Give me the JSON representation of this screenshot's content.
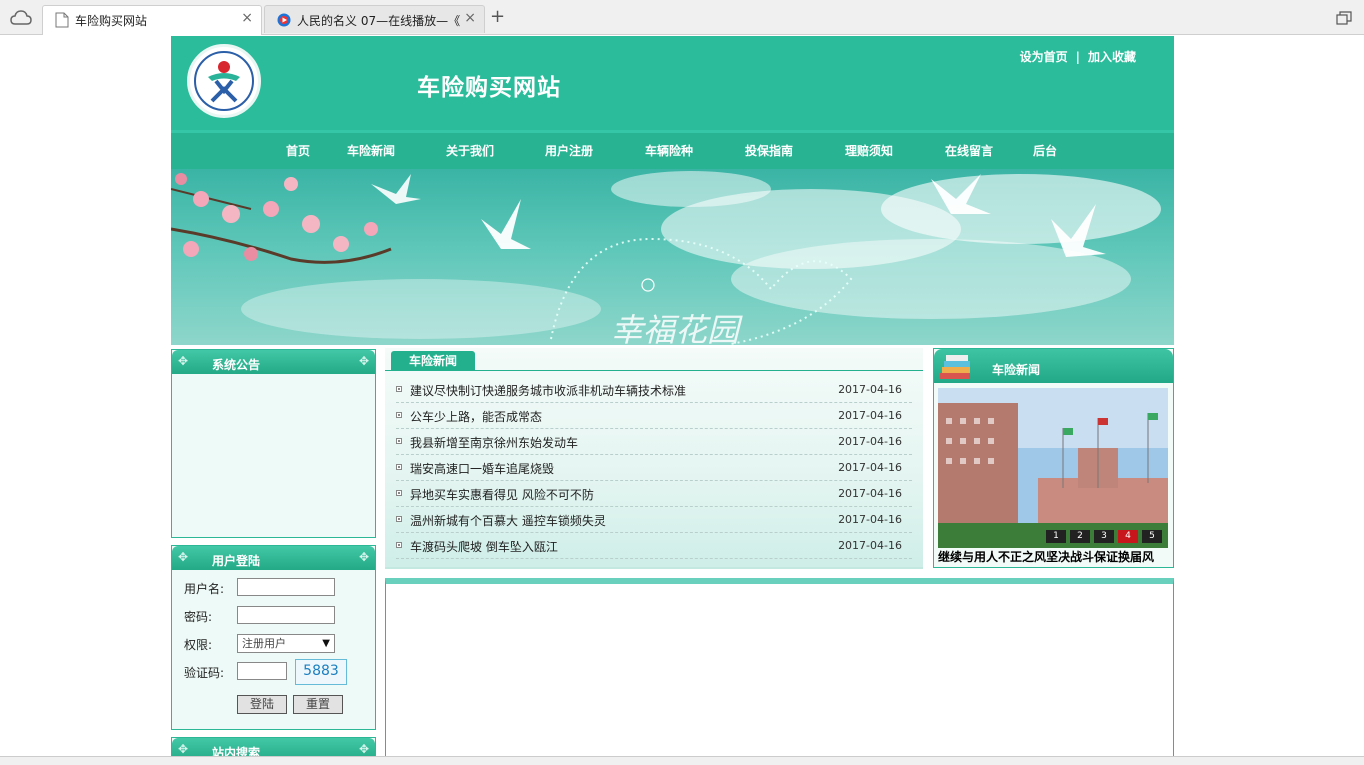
{
  "browser": {
    "tabs": [
      {
        "label": "车险购买网站",
        "active": true
      },
      {
        "label": "人民的名义 07—在线播放—《",
        "active": false
      }
    ],
    "new_tab_symbol": "+",
    "close_symbol": "×"
  },
  "header": {
    "site_title": "车险购买网站",
    "top_links": [
      "设为首页",
      "加入收藏"
    ],
    "separator": "|"
  },
  "nav": {
    "items": [
      "首页",
      "车险新闻",
      "关于我们",
      "用户注册",
      "车辆险种",
      "投保指南",
      "理赔须知",
      "在线留言",
      "后台"
    ]
  },
  "announcement": {
    "title": "系统公告"
  },
  "login": {
    "title": "用户登陆",
    "username_label": "用户名:",
    "password_label": "密码:",
    "role_label": "权限:",
    "role_selected": "注册用户",
    "captcha_label": "验证码:",
    "captcha_value": "5883",
    "login_button": "登陆",
    "reset_button": "重置"
  },
  "site_search": {
    "title": "站内搜索"
  },
  "news_center": {
    "tab_label": "车险新闻",
    "items": [
      {
        "title": "建议尽快制订快递服务城市收派非机动车辆技术标准",
        "date": "2017-04-16"
      },
      {
        "title": "公车少上路，能否成常态",
        "date": "2017-04-16"
      },
      {
        "title": "我县新增至南京徐州东始发动车",
        "date": "2017-04-16"
      },
      {
        "title": "瑞安高速口一婚车追尾烧毁",
        "date": "2017-04-16"
      },
      {
        "title": "异地买车实惠看得见 风险不可不防",
        "date": "2017-04-16"
      },
      {
        "title": "温州新城有个百慕大 遥控车锁频失灵",
        "date": "2017-04-16"
      },
      {
        "title": "车渡码头爬坡 倒车坠入瓯江",
        "date": "2017-04-16"
      }
    ]
  },
  "news_right": {
    "title": "车险新闻",
    "slide_numbers": [
      "1",
      "2",
      "3",
      "4",
      "5"
    ],
    "active_slide": 4,
    "caption": "继续与用人不正之风坚决战斗保证换届风"
  },
  "colors": {
    "brand": "#2bbc9b",
    "nav": "#28b492",
    "active_slide": "#c8161d"
  }
}
